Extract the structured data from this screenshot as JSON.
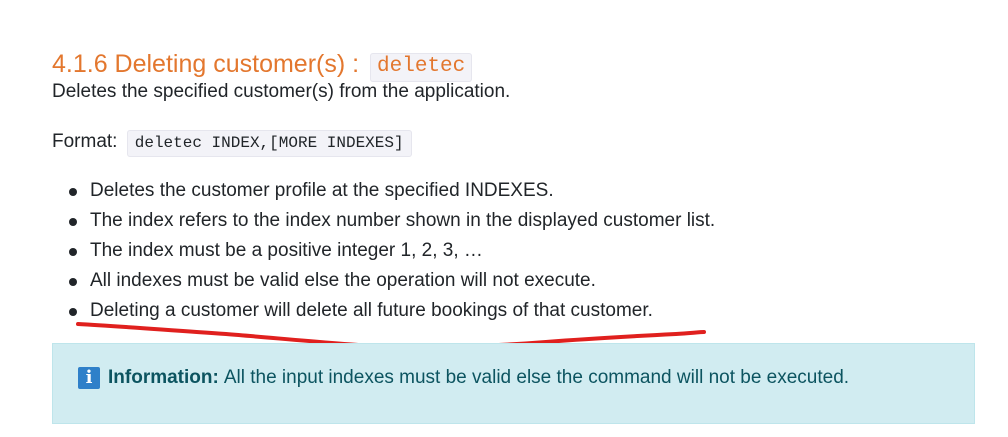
{
  "section": {
    "title": "4.1.6 Deleting customer(s) :",
    "command": "deletec"
  },
  "description": "Deletes the specified customer(s) from the application.",
  "format": {
    "label": "Format:",
    "code": "deletec INDEX,[MORE INDEXES]"
  },
  "bullets": [
    "Deletes the customer profile at the specified INDEXES.",
    "The index refers to the index number shown in the displayed customer list.",
    "The index must be a positive integer 1, 2, 3, …",
    "All indexes must be valid else the operation will not execute.",
    "Deleting a customer will delete all future bookings of that customer."
  ],
  "info": {
    "icon": "info-icon",
    "label": "Information:",
    "text": "All the input indexes must be valid else the command will not be executed."
  },
  "colors": {
    "heading": "#e3772e",
    "annotation": "#e0201e",
    "info_background": "#d1ecf1",
    "info_text": "#0c5460",
    "info_icon": "#2f80c9"
  }
}
